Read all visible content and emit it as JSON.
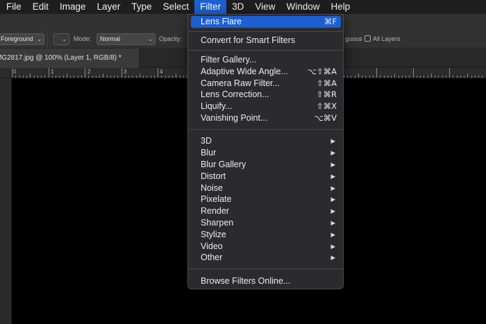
{
  "menubar": {
    "items": [
      "File",
      "Edit",
      "Image",
      "Layer",
      "Type",
      "Select",
      "Filter",
      "3D",
      "View",
      "Window",
      "Help"
    ],
    "active": "Filter"
  },
  "options_bar": {
    "fill_source": "Foreground",
    "mode_label": "Mode:",
    "mode_value": "Normal",
    "opacity_label": "Opacity:",
    "contiguous_label": "guous",
    "all_layers_label": "All Layers"
  },
  "document_tab": {
    "title": "MG2817.jpg @ 100% (Layer 1, RGB/8) *"
  },
  "ruler": {
    "numbers": [
      "0",
      "1",
      "2",
      "3",
      "4"
    ]
  },
  "filter_menu": {
    "highlight": {
      "label": "Lens Flare",
      "shortcut": "⌘F"
    },
    "convert": "Convert for Smart Filters",
    "group1": [
      {
        "label": "Filter Gallery...",
        "shortcut": ""
      },
      {
        "label": "Adaptive Wide Angle...",
        "shortcut": "⌥⇧⌘A"
      },
      {
        "label": "Camera Raw Filter...",
        "shortcut": "⇧⌘A"
      },
      {
        "label": "Lens Correction...",
        "shortcut": "⇧⌘R"
      },
      {
        "label": "Liquify...",
        "shortcut": "⇧⌘X"
      },
      {
        "label": "Vanishing Point...",
        "shortcut": "⌥⌘V"
      }
    ],
    "submenus": [
      "3D",
      "Blur",
      "Blur Gallery",
      "Distort",
      "Noise",
      "Pixelate",
      "Render",
      "Sharpen",
      "Stylize",
      "Video",
      "Other"
    ],
    "submenu_arrow": "▶",
    "browse": "Browse Filters Online..."
  },
  "colors": {
    "menu_highlight": "#1c5fd1",
    "menu_bg": "#2b2b2d",
    "canvas": "#000000"
  }
}
